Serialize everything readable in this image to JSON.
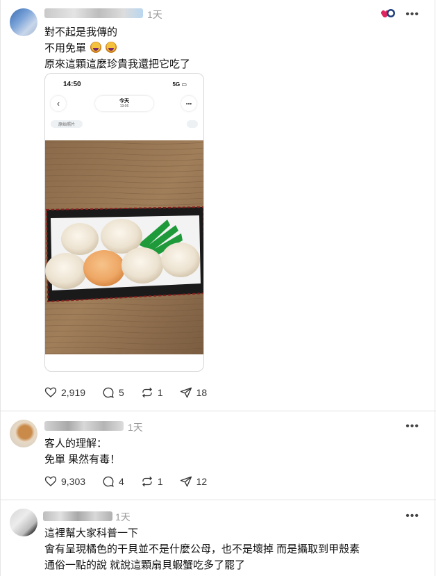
{
  "posts": [
    {
      "time": "1天",
      "lines": [
        "對不起是我傳的",
        "不用免單",
        "原來這顆這麼珍貴我還把它吃了"
      ],
      "media": {
        "status_time": "14:50",
        "status_network": "5G",
        "header_title": "今天",
        "header_time": "13:06",
        "subheader": "原始照片"
      },
      "stats": {
        "likes": "2,919",
        "comments": "5",
        "reposts": "1",
        "shares": "18"
      }
    },
    {
      "time": "1天",
      "lines": [
        "客人的理解：",
        "免單 果然有毒！"
      ],
      "stats": {
        "likes": "9,303",
        "comments": "4",
        "reposts": "1",
        "shares": "12"
      }
    },
    {
      "time": "1天",
      "lines": [
        "這裡幫大家科普一下",
        "會有呈現橘色的干貝並不是什麼公母，也不是壞掉 而是攝取到甲殼素",
        "通俗一點的說 就說這顆扇貝蝦蟹吃多了罷了"
      ]
    }
  ],
  "icons": {
    "like": "heart-icon",
    "comment": "comment-bubble-icon",
    "repost": "repost-icon",
    "share": "send-icon",
    "more": "more-horizontal-icon",
    "badge": "heart-badge-icon"
  },
  "colors": {
    "divider": "#e0e0e0",
    "muted": "#999999",
    "text": "#111111"
  }
}
